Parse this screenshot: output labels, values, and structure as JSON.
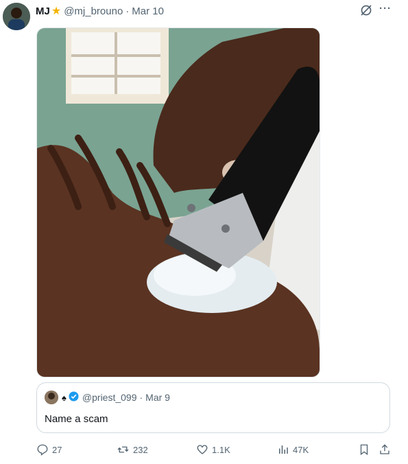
{
  "tweet": {
    "display_name": "MJ",
    "badge_icon": "star-icon",
    "handle": "@mj_brouno",
    "separator": "·",
    "date": "Mar 10",
    "grok_icon": "grok-icon",
    "more_label": "···"
  },
  "media": {
    "description_icon": "photo-hand-clipper"
  },
  "quote": {
    "handle": "@priest_099",
    "separator": "·",
    "date": "Mar 9",
    "text": "Name a scam",
    "badges": [
      "spade-icon",
      "verified-badge-icon"
    ]
  },
  "actions": {
    "replies": "27",
    "reposts": "232",
    "likes": "1.1K",
    "views": "47K"
  },
  "colors": {
    "muted": "#536471",
    "verified": "#1d9bf0",
    "star": "#f4b400",
    "border": "#cfd9de"
  }
}
